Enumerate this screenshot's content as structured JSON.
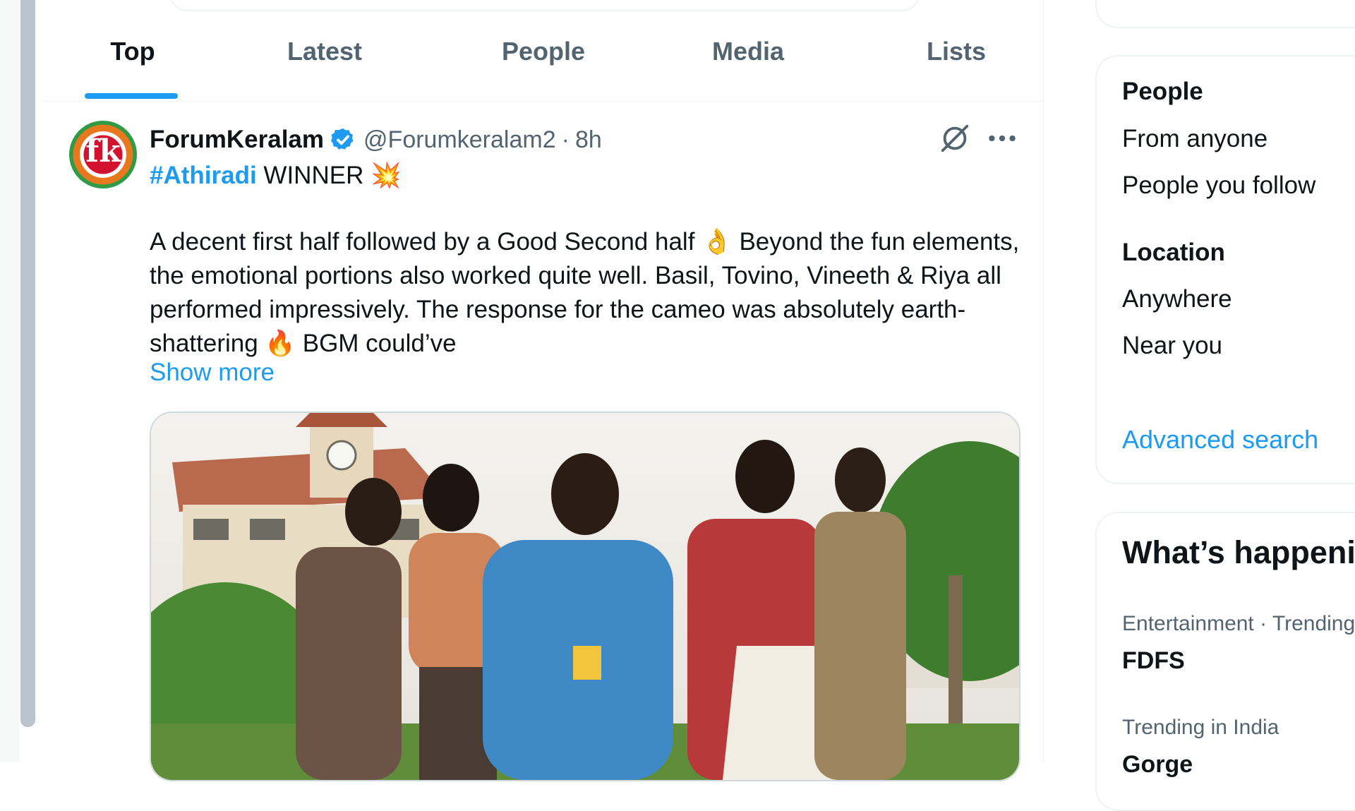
{
  "tabs": [
    "Top",
    "Latest",
    "People",
    "Media",
    "Lists"
  ],
  "tweet": {
    "display_name": "ForumKeralam",
    "handle": "@Forumkeralam2",
    "separator": "·",
    "time": "8h",
    "avatar_text": "fk",
    "hashtag": "#Athiradi",
    "line1_rest": " WINNER 💥",
    "body": "A decent first half followed by a Good Second half 👌 Beyond the fun elements, the emotional portions also worked quite well. Basil, Tovino, Vineeth & Riya all performed impressively. The response for the cameo was absolutely earth-shattering 🔥 BGM could’ve",
    "show_more": "Show more"
  },
  "search_filters": {
    "people_heading": "People",
    "people_options": [
      "From anyone",
      "People you follow"
    ],
    "location_heading": "Location",
    "location_options": [
      "Anywhere",
      "Near you"
    ],
    "advanced_search": "Advanced search"
  },
  "whats_happening": {
    "title": "What’s happening",
    "trends": [
      {
        "meta": "Entertainment · Trending",
        "name": "FDFS"
      },
      {
        "meta": "Trending in India",
        "name": "Gorge"
      }
    ]
  },
  "colors": {
    "accent": "#1d9bf0",
    "text_primary": "#0f1419",
    "text_secondary": "#536471",
    "border": "#eff3f4"
  },
  "icons": [
    "verified-badge-icon",
    "grok-icon",
    "more-icon"
  ]
}
